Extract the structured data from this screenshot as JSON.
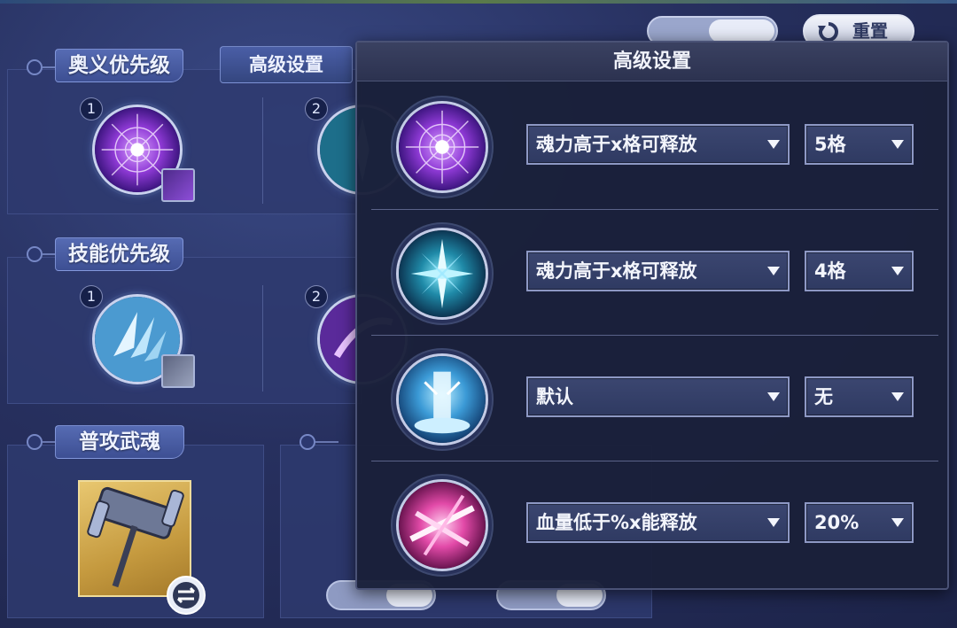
{
  "top": {
    "reset_label": "重置"
  },
  "sections": {
    "ultimate_priority_label": "奥义优先级",
    "advanced_settings_tab_label": "高级设置",
    "skill_priority_label": "技能优先级",
    "basic_attack_label": "普攻武魂",
    "ultimate_slots": [
      "1",
      "2"
    ],
    "skill_slots": [
      "1",
      "2"
    ]
  },
  "advanced_panel": {
    "title": "高级设置",
    "rows": [
      {
        "icon": "spider-web-skill-icon",
        "condition": "魂力高于x格可释放",
        "value": "5格"
      },
      {
        "icon": "ice-crystal-skill-icon",
        "condition": "魂力高于x格可释放",
        "value": "4格"
      },
      {
        "icon": "water-pillar-skill-icon",
        "condition": "默认",
        "value": "无"
      },
      {
        "icon": "pink-slash-skill-icon",
        "condition": "血量低于%x能释放",
        "value": "20%"
      }
    ]
  },
  "colors": {
    "accent_tab": "#4a5ea6",
    "panel_bg": "#1a203a",
    "weapon_card": "#c59a3f"
  }
}
